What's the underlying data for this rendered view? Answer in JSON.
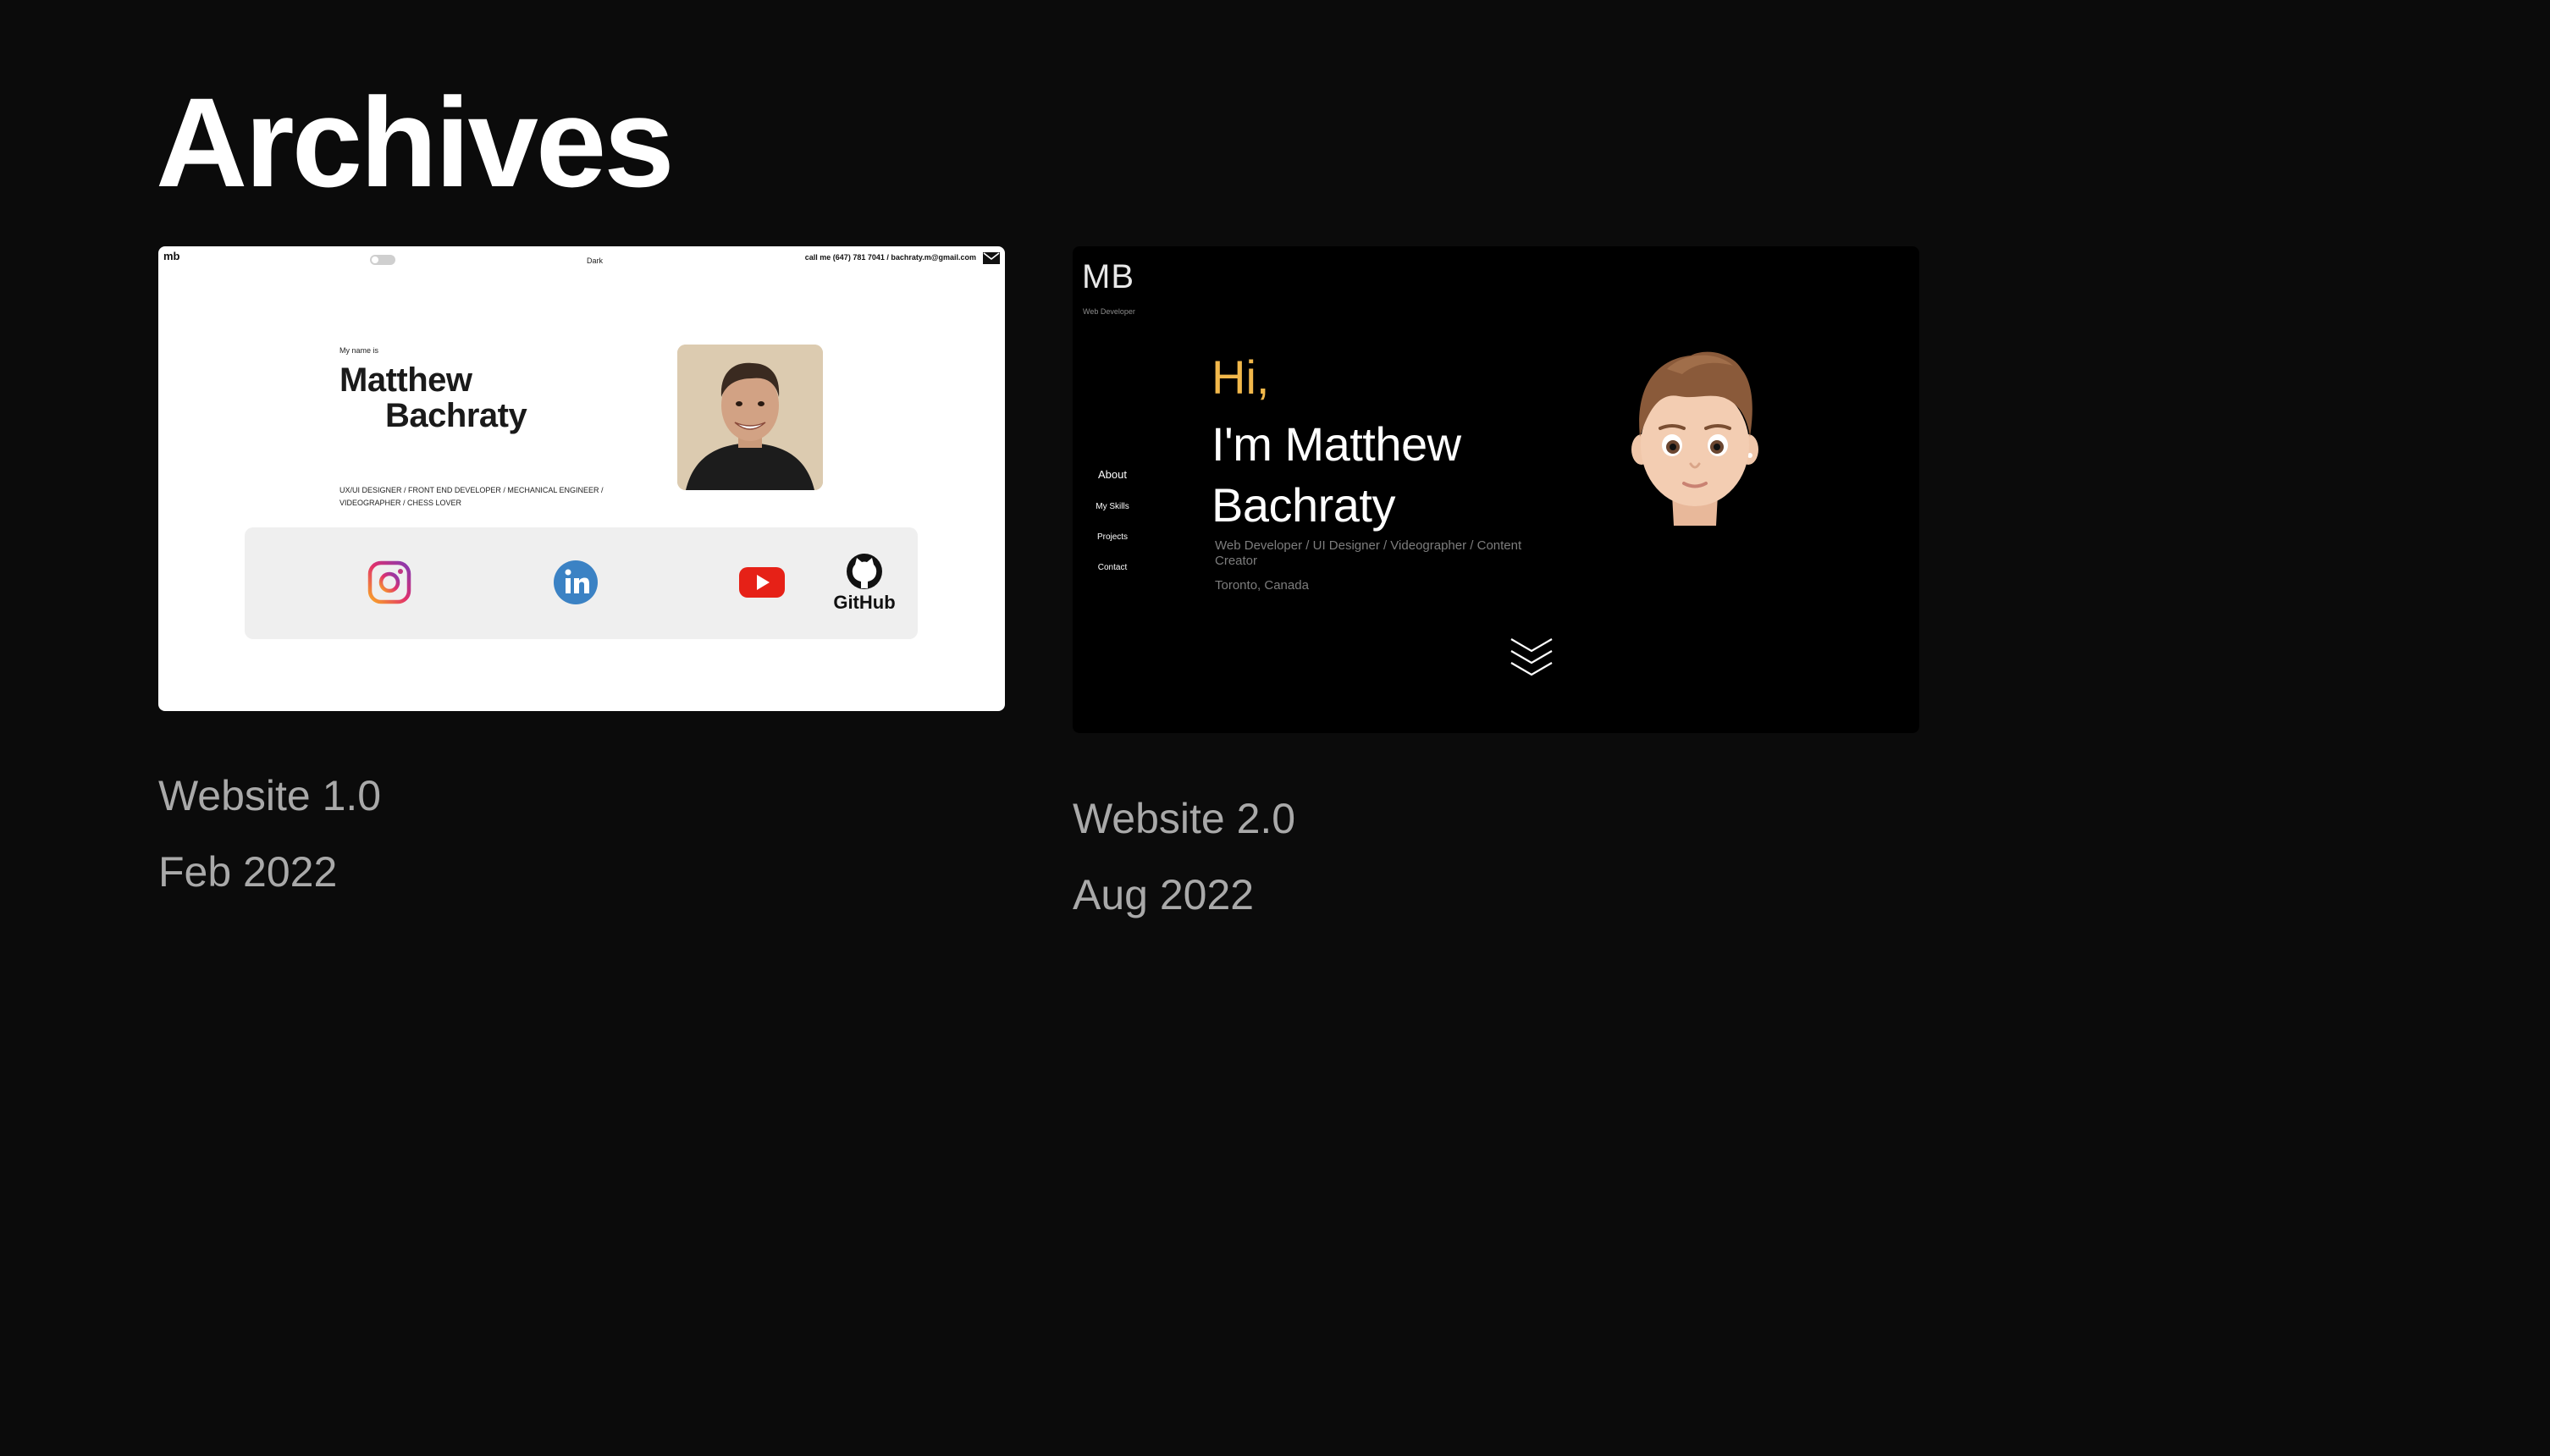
{
  "page": {
    "title": "Archives"
  },
  "archives": [
    {
      "title": "Website 1.0",
      "date": "Feb 2022",
      "preview": {
        "logo": "mb",
        "mode_label": "Dark",
        "contact": "call me (647) 781 7041 / bachraty.m@gmail.com",
        "intro": "My name is",
        "name_line1": "Matthew",
        "name_line2": "Bachraty",
        "roles": "UX/UI DESIGNER / FRONT END DEVELOPER / MECHANICAL ENGINEER / VIDEOGRAPHER / CHESS LOVER",
        "social_icons": [
          "instagram-icon",
          "linkedin-icon",
          "youtube-icon",
          "github-icon"
        ],
        "github_text": "GitHub"
      }
    },
    {
      "title": "Website 2.0",
      "date": "Aug 2022",
      "preview": {
        "logo": "MB",
        "subtitle": "Web Developer",
        "nav": [
          "About",
          "My Skills",
          "Projects",
          "Contact"
        ],
        "greeting": "Hi,",
        "name": "I'm Matthew Bachraty",
        "roles": "Web Developer / UI Designer / Videographer / Content Creator",
        "location": "Toronto, Canada",
        "accent_color": "#f2b84b"
      }
    }
  ]
}
